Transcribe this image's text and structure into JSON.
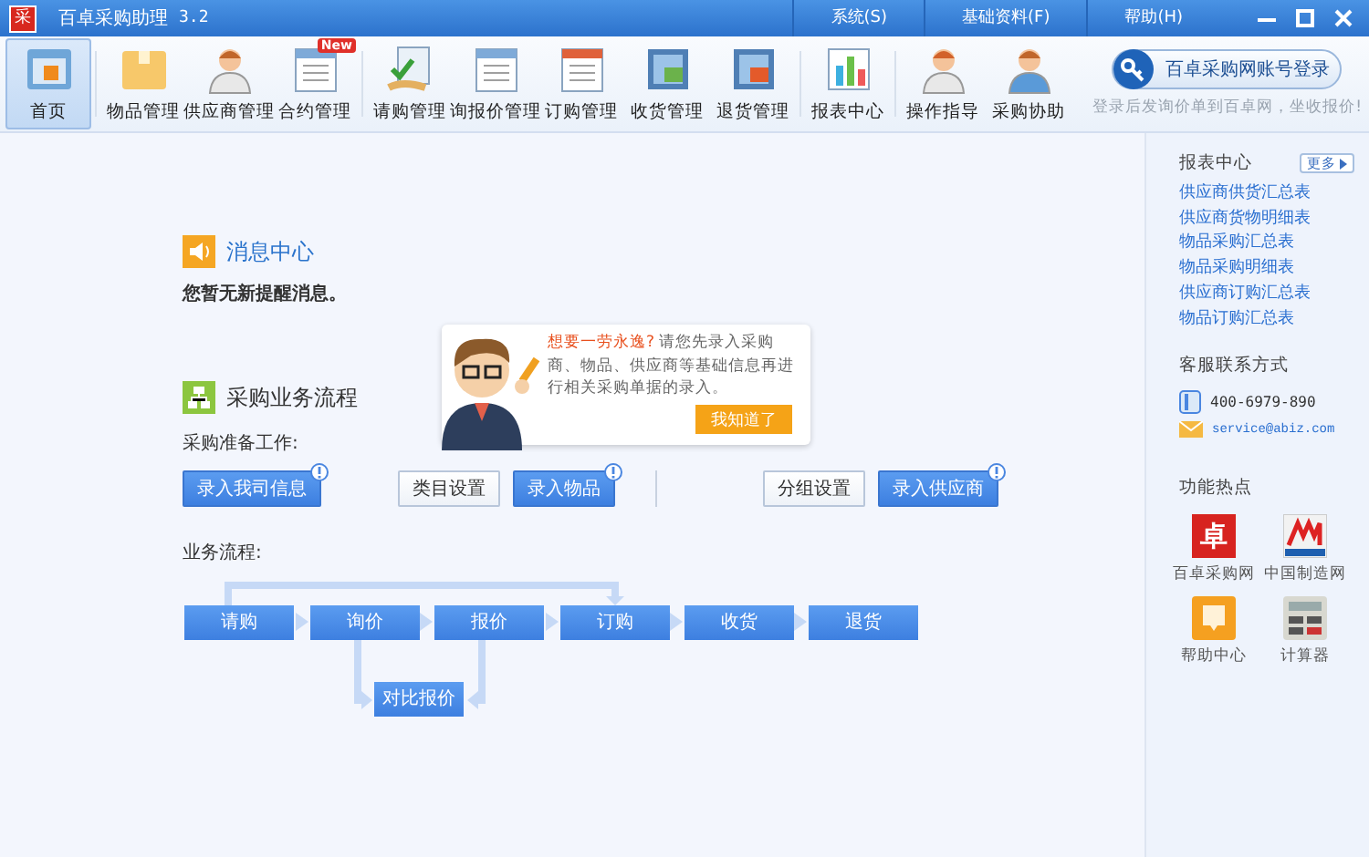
{
  "window": {
    "logo": "采",
    "title": "百卓采购助理",
    "version": "3.2",
    "menus": [
      "系统(S)",
      "基础资料(F)",
      "帮助(H)"
    ]
  },
  "toolbar": {
    "groups": [
      [
        {
          "label": "首页",
          "selected": true
        }
      ],
      [
        {
          "label": "物品管理",
          "selected": false
        },
        {
          "label": "供应商管理",
          "selected": false
        },
        {
          "label": "合约管理",
          "selected": false,
          "badge": "New"
        }
      ],
      [
        {
          "label": "请购管理",
          "selected": false
        },
        {
          "label": "询报价管理",
          "selected": false
        },
        {
          "label": "订购管理",
          "selected": false
        },
        {
          "label": "收货管理",
          "selected": false
        },
        {
          "label": "退货管理",
          "selected": false
        }
      ],
      [
        {
          "label": "报表中心",
          "selected": false
        }
      ],
      [
        {
          "label": "操作指导",
          "selected": false
        },
        {
          "label": "采购协助",
          "selected": false
        }
      ]
    ]
  },
  "login": {
    "button": "百卓采购网账号登录",
    "hint": "登录后发询价单到百卓网，坐收报价!"
  },
  "messages": {
    "title": "消息中心",
    "text": "您暂无新提醒消息。"
  },
  "process": {
    "title": "采购业务流程",
    "prep_label": "采购准备工作:",
    "prep_groups": [
      [
        {
          "label": "录入我司信息",
          "kind": "primary",
          "alert": true
        },
        {
          "label": "类目设置",
          "kind": "secondary",
          "alert": false
        },
        {
          "label": "录入物品",
          "kind": "primary",
          "alert": true
        }
      ],
      [
        {
          "label": "分组设置",
          "kind": "secondary",
          "alert": false
        },
        {
          "label": "录入供应商",
          "kind": "primary",
          "alert": true
        }
      ]
    ],
    "flow_label": "业务流程:",
    "flow_steps": [
      "请购",
      "询价",
      "报价",
      "订购",
      "收货",
      "退货"
    ],
    "compare_step": "对比报价"
  },
  "tip": {
    "highlight": "想要一劳永逸?",
    "text": "请您先录入采购商、物品、供应商等基础信息再进行相关采购单据的录入。",
    "button": "我知道了"
  },
  "sidebar": {
    "reports": {
      "title": "报表中心",
      "more": "更多",
      "links": [
        "供应商供货汇总表",
        "供应商货物明细表",
        "物品采购汇总表",
        "物品采购明细表",
        "供应商订购汇总表",
        "物品订购汇总表"
      ]
    },
    "contact": {
      "title": "客服联系方式",
      "phone": "400-6979-890",
      "email": "service@abiz.com"
    },
    "hot": {
      "title": "功能热点",
      "items": [
        {
          "label": "百卓采购网",
          "kind": "baizhuo",
          "logo_text": "卓"
        },
        {
          "label": "中国制造网",
          "kind": "madeinchina"
        },
        {
          "label": "帮助中心",
          "kind": "help"
        },
        {
          "label": "计算器",
          "kind": "calculator"
        }
      ]
    }
  }
}
